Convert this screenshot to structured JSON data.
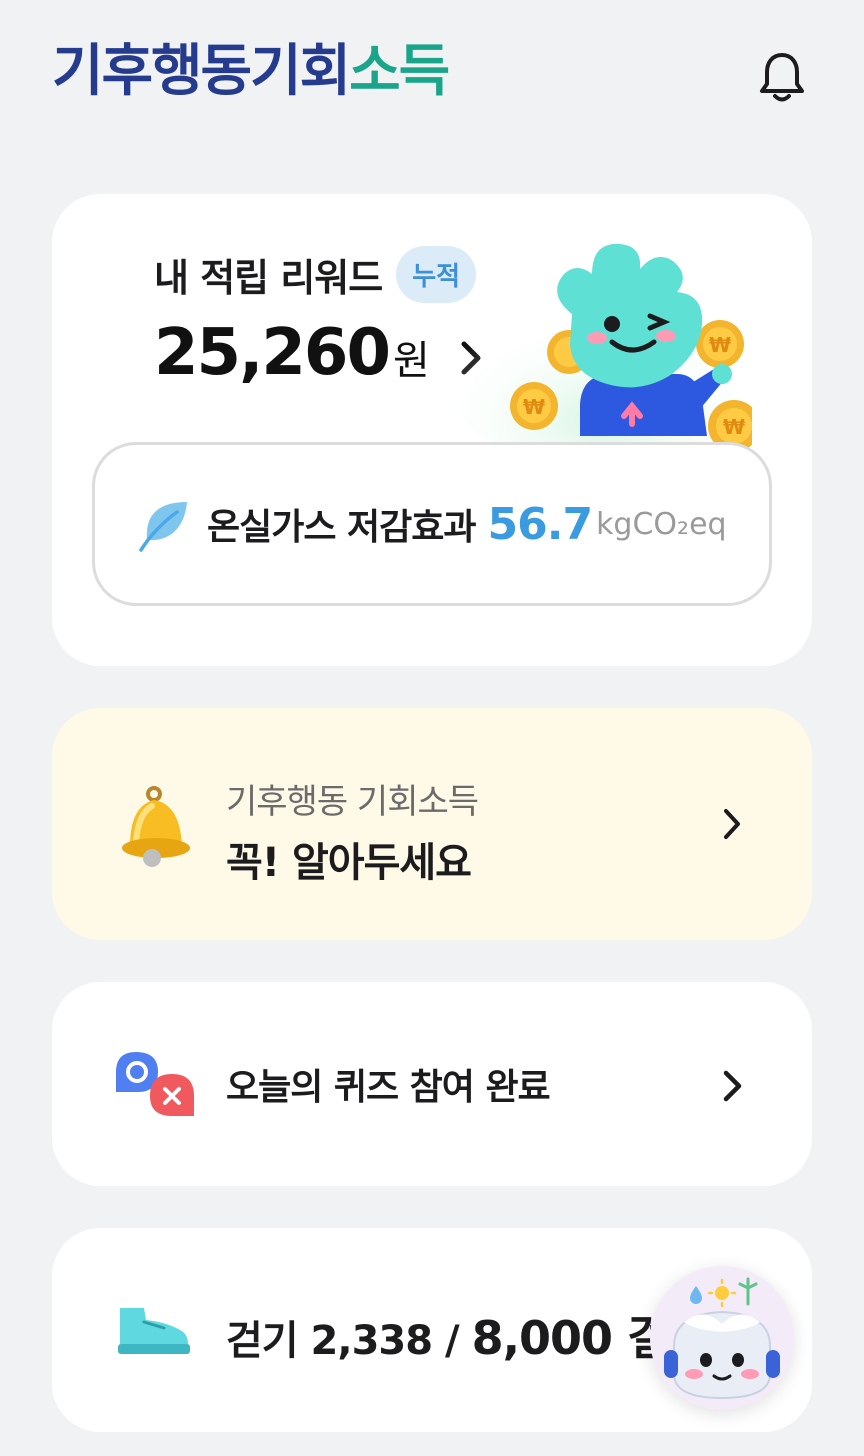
{
  "header": {
    "logo_part1": "기후행동",
    "logo_part2": "기회",
    "logo_part3": "소득"
  },
  "reward": {
    "title": "내 적립 리워드",
    "badge": "누적",
    "amount": "25,260",
    "unit": "원"
  },
  "ghg": {
    "label": "온실가스 저감효과",
    "value": "56.7",
    "unit": "kgCO₂eq"
  },
  "notice": {
    "subtitle": "기후행동 기회소득",
    "title": "꼭! 알아두세요"
  },
  "quiz": {
    "label": "오늘의 퀴즈 참여 완료"
  },
  "walk": {
    "prefix": "걷기",
    "count": "2,338",
    "separator": "/",
    "goal": "8,000 걸"
  },
  "colors": {
    "logo_blue": "#253c8e",
    "logo_green": "#1aa58a",
    "accent_blue": "#3b9be0",
    "notice_bg": "#fff9e8",
    "badge_bg": "#dcebf8"
  },
  "icons": {
    "notifications": "bell-outline-icon",
    "ghg": "leaf-icon",
    "notice": "golden-bell-icon",
    "quiz": "ox-quiz-icon",
    "walk": "sneaker-icon",
    "assistant": "robot-assistant-icon"
  }
}
